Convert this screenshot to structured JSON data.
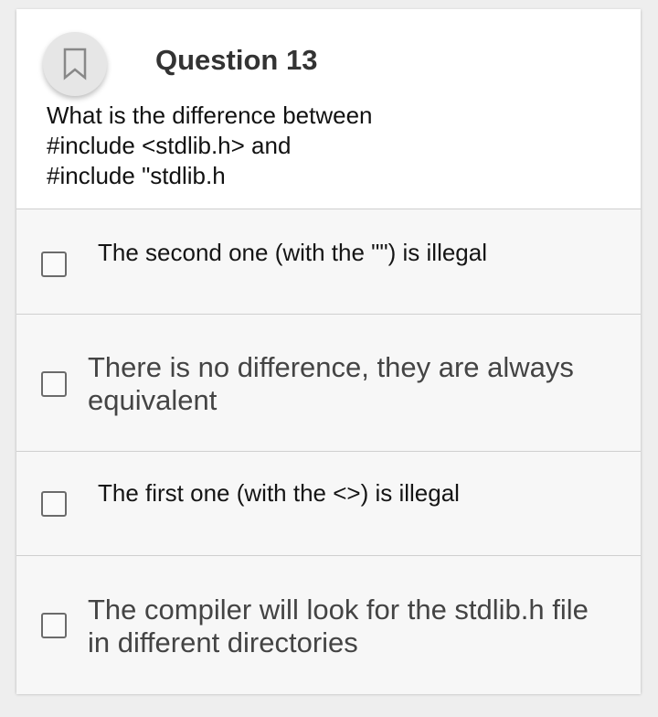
{
  "question": {
    "title": "Question 13",
    "lines": [
      "What is the difference between",
      "#include <stdlib.h> and",
      "#include \"stdlib.h"
    ]
  },
  "options": [
    {
      "label": "The second one (with the \"\") is illegal",
      "checked": false
    },
    {
      "label": "There is no difference, they are always equivalent",
      "checked": false
    },
    {
      "label": "The first one (with the <>) is illegal",
      "checked": false
    },
    {
      "label": "The compiler will look for the stdlib.h file in different directories",
      "checked": false
    }
  ],
  "icons": {
    "bookmark": "bookmark-icon"
  }
}
